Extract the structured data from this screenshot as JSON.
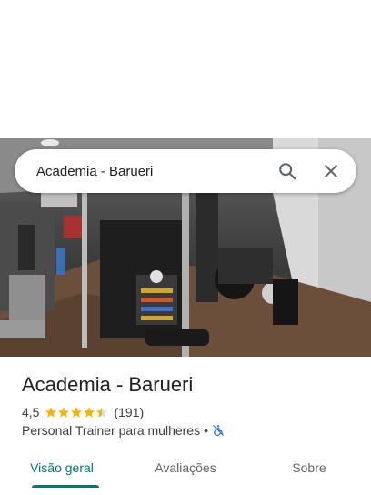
{
  "search": {
    "query": "Academia - Barueri",
    "search_icon": "search-icon",
    "close_icon": "close-icon"
  },
  "place": {
    "title": "Academia - Barueri",
    "rating": "4,5",
    "rating_value": 4.5,
    "review_count": "(191)",
    "category": "Personal Trainer para mulheres",
    "separator": "•",
    "accessibility_icon": "not-wheelchair-accessible-icon"
  },
  "tabs": [
    {
      "label": "Visão geral",
      "active": true
    },
    {
      "label": "Avaliações",
      "active": false
    },
    {
      "label": "Sobre",
      "active": false
    }
  ],
  "colors": {
    "accent": "#00796b",
    "star": "#f4b400",
    "accessibility_icon": "#1a73e8"
  }
}
